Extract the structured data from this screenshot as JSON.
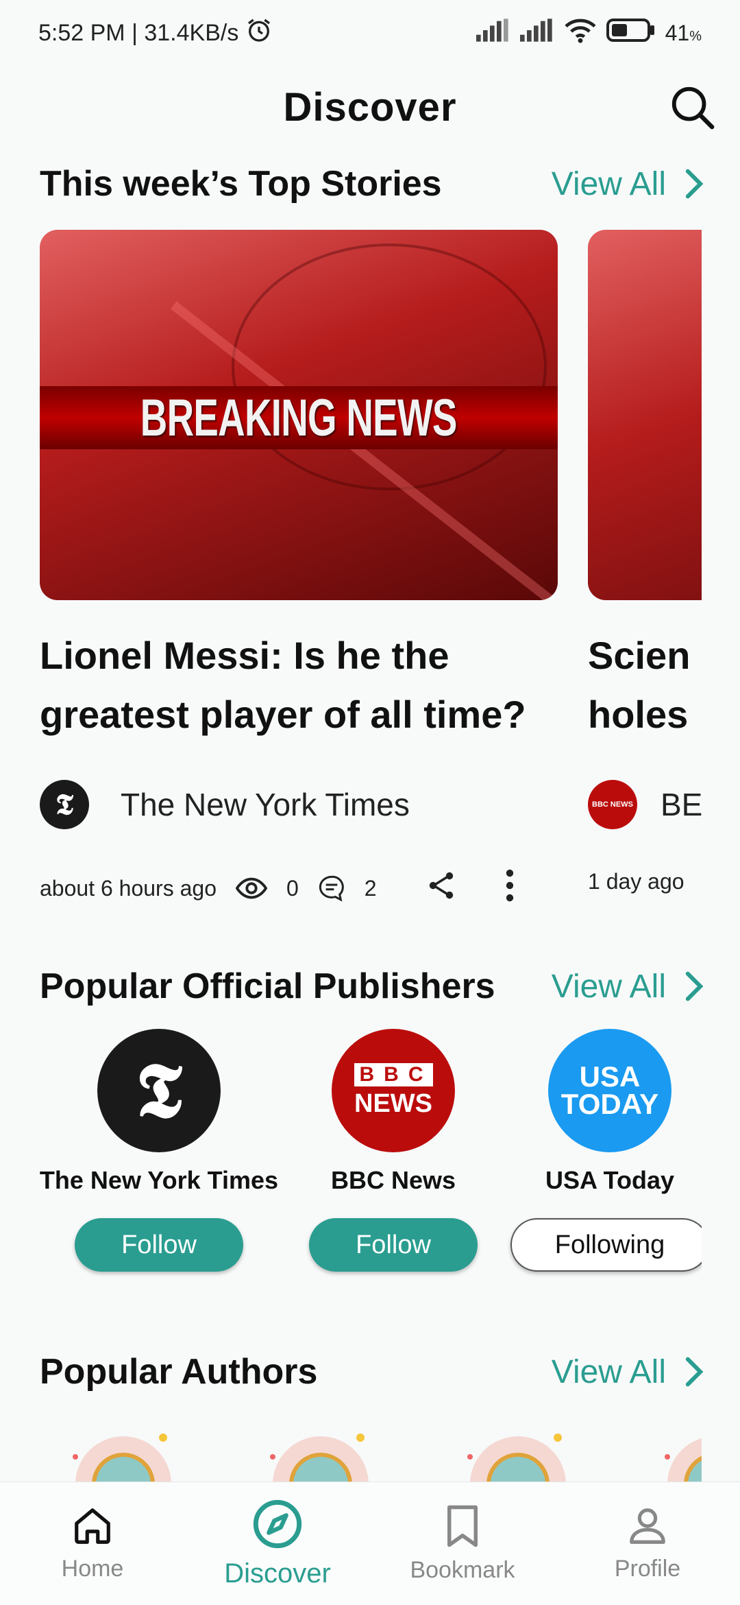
{
  "status_bar": {
    "time_speed": "5:52 PM | 31.4KB/s",
    "battery": "41",
    "battery_suffix": "%"
  },
  "header": {
    "title": "Discover"
  },
  "top_stories": {
    "title": "This week’s Top Stories",
    "view_all": "View All",
    "cards": [
      {
        "image_text": "BREAKING NEWS",
        "title_line1": "Lionel Messi: Is he the",
        "title_line2": "greatest player of all time?",
        "publisher": "The New York Times",
        "publisher_logo": "𝕿",
        "time": "about 6 hours ago",
        "views": "0",
        "comments": "2"
      },
      {
        "title_line1": "Scien",
        "title_line2": "holes",
        "publisher": "BE",
        "publisher_logo": "BBC NEWS",
        "time": "1 day ago"
      }
    ]
  },
  "publishers": {
    "title": "Popular Official Publishers",
    "view_all": "View All",
    "items": [
      {
        "name": "The New York Times",
        "logo": "𝕿",
        "button": "Follow",
        "color": "#1a1a1a"
      },
      {
        "name": "BBC News",
        "logo_top": "BBC",
        "logo_bottom": "NEWS",
        "button": "Follow",
        "color": "#bb0c0c"
      },
      {
        "name": "USA Today",
        "logo_top": "USA",
        "logo_bottom": "TODAY",
        "button": "Following",
        "color": "#1a9af0"
      }
    ]
  },
  "authors": {
    "title": "Popular Authors",
    "view_all": "View All"
  },
  "nav": {
    "home": "Home",
    "discover": "Discover",
    "bookmark": "Bookmark",
    "profile": "Profile"
  },
  "colors": {
    "accent": "#2a9d90",
    "bbc_red": "#bb0c0c",
    "usa_blue": "#1a9af0"
  }
}
